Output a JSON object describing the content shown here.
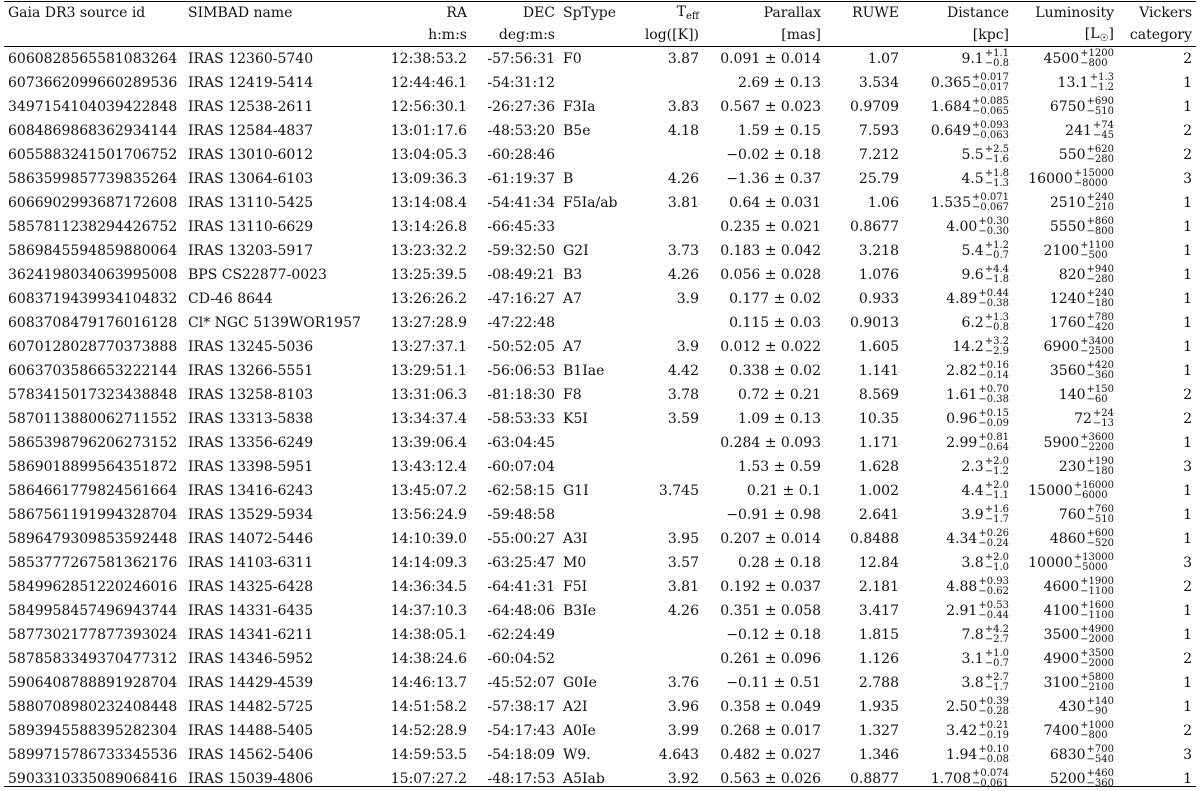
{
  "headers": {
    "gaia": "Gaia DR3 source id",
    "simbad": "SIMBAD name",
    "ra": "RA",
    "dec": "DEC",
    "sptype": "SpType",
    "teff_main": "T",
    "teff_sub": "eff",
    "parallax": "Parallax",
    "ruwe": "RUWE",
    "distance": "Distance",
    "luminosity": "Luminosity",
    "vickers": "Vickers"
  },
  "units": {
    "ra": "h:m:s",
    "dec": "deg:m:s",
    "teff": "log([K])",
    "parallax": "[mas]",
    "distance": "[kpc]",
    "luminosity_pre": "[L",
    "luminosity_sym": "☉",
    "luminosity_post": "]",
    "vickers": "category"
  },
  "rows": [
    {
      "gaia": "6060828565581083264",
      "name": "IRAS 12360-5740",
      "ra": "12:38:53.2",
      "dec": "-57:56:31",
      "sp": "F0",
      "teff": "3.87",
      "plx": "0.091 ± 0.014",
      "ruwe": "1.07",
      "dist": "9.1",
      "dist_up": "+1.1",
      "dist_dn": "−0.8",
      "lum": "4500",
      "lum_up": "+1200",
      "lum_dn": "−800",
      "vc": "2"
    },
    {
      "gaia": "6073662099660289536",
      "name": "IRAS 12419-5414",
      "ra": "12:44:46.1",
      "dec": "-54:31:12",
      "sp": "",
      "teff": "",
      "plx": "2.69 ± 0.13",
      "ruwe": "3.534",
      "dist": "0.365",
      "dist_up": "+0.017",
      "dist_dn": "−0.017",
      "lum": "13.1",
      "lum_up": "+1.3",
      "lum_dn": "−1.2",
      "vc": "1"
    },
    {
      "gaia": "3497154104039422848",
      "name": "IRAS 12538-2611",
      "ra": "12:56:30.1",
      "dec": "-26:27:36",
      "sp": "F3Ia",
      "teff": "3.83",
      "plx": "0.567 ± 0.023",
      "ruwe": "0.9709",
      "dist": "1.684",
      "dist_up": "+0.085",
      "dist_dn": "−0.065",
      "lum": "6750",
      "lum_up": "+690",
      "lum_dn": "−510",
      "vc": "1"
    },
    {
      "gaia": "6084869868362934144",
      "name": "IRAS 12584-4837",
      "ra": "13:01:17.6",
      "dec": "-48:53:20",
      "sp": "B5e",
      "teff": "4.18",
      "plx": "1.59 ± 0.15",
      "ruwe": "7.593",
      "dist": "0.649",
      "dist_up": "+0.093",
      "dist_dn": "−0.063",
      "lum": "241",
      "lum_up": "+74",
      "lum_dn": "−45",
      "vc": "2"
    },
    {
      "gaia": "6055883241501706752",
      "name": "IRAS 13010-6012",
      "ra": "13:04:05.3",
      "dec": "-60:28:46",
      "sp": "",
      "teff": "",
      "plx": "−0.02 ± 0.18",
      "ruwe": "7.212",
      "dist": "5.5",
      "dist_up": "+2.5",
      "dist_dn": "−1.6",
      "lum": "550",
      "lum_up": "+620",
      "lum_dn": "−280",
      "vc": "2"
    },
    {
      "gaia": "5863599857739835264",
      "name": "IRAS 13064-6103",
      "ra": "13:09:36.3",
      "dec": "-61:19:37",
      "sp": "B",
      "teff": "4.26",
      "plx": "−1.36 ± 0.37",
      "ruwe": "25.79",
      "dist": "4.5",
      "dist_up": "+1.8",
      "dist_dn": "−1.3",
      "lum": "16000",
      "lum_up": "+15000",
      "lum_dn": "−8000",
      "vc": "3"
    },
    {
      "gaia": "6066902993687172608",
      "name": "IRAS 13110-5425",
      "ra": "13:14:08.4",
      "dec": "-54:41:34",
      "sp": "F5Ia/ab",
      "teff": "3.81",
      "plx": "0.64 ± 0.031",
      "ruwe": "1.06",
      "dist": "1.535",
      "dist_up": "+0.071",
      "dist_dn": "−0.067",
      "lum": "2510",
      "lum_up": "+240",
      "lum_dn": "−210",
      "vc": "1"
    },
    {
      "gaia": "5857811238294426752",
      "name": "IRAS 13110-6629",
      "ra": "13:14:26.8",
      "dec": "-66:45:33",
      "sp": "",
      "teff": "",
      "plx": "0.235 ± 0.021",
      "ruwe": "0.8677",
      "dist": "4.00",
      "dist_up": "+0.30",
      "dist_dn": "−0.30",
      "lum": "5550",
      "lum_up": "+860",
      "lum_dn": "−800",
      "vc": "1"
    },
    {
      "gaia": "5869845594859880064",
      "name": "IRAS 13203-5917",
      "ra": "13:23:32.2",
      "dec": "-59:32:50",
      "sp": "G2I",
      "teff": "3.73",
      "plx": "0.183 ± 0.042",
      "ruwe": "3.218",
      "dist": "5.4",
      "dist_up": "+1.2",
      "dist_dn": "−0.7",
      "lum": "2100",
      "lum_up": "+1100",
      "lum_dn": "−500",
      "vc": "1"
    },
    {
      "gaia": "3624198034063995008",
      "name": "BPS CS22877-0023",
      "ra": "13:25:39.5",
      "dec": "-08:49:21",
      "sp": "B3",
      "teff": "4.26",
      "plx": "0.056 ± 0.028",
      "ruwe": "1.076",
      "dist": "9.6",
      "dist_up": "+4.4",
      "dist_dn": "−1.8",
      "lum": "820",
      "lum_up": "+940",
      "lum_dn": "−280",
      "vc": "1"
    },
    {
      "gaia": "6083719439934104832",
      "name": "CD-46 8644",
      "ra": "13:26:26.2",
      "dec": "-47:16:27",
      "sp": "A7",
      "teff": "3.9",
      "plx": "0.177 ± 0.02",
      "ruwe": "0.933",
      "dist": "4.89",
      "dist_up": "+0.44",
      "dist_dn": "−0.38",
      "lum": "1240",
      "lum_up": "+240",
      "lum_dn": "−180",
      "vc": "1"
    },
    {
      "gaia": "6083708479176016128",
      "name": "Cl* NGC 5139WOR1957",
      "ra": "13:27:28.9",
      "dec": "-47:22:48",
      "sp": "",
      "teff": "",
      "plx": "0.115 ± 0.03",
      "ruwe": "0.9013",
      "dist": "6.2",
      "dist_up": "+1.3",
      "dist_dn": "−0.8",
      "lum": "1760",
      "lum_up": "+780",
      "lum_dn": "−420",
      "vc": "1"
    },
    {
      "gaia": "6070128028770373888",
      "name": "IRAS 13245-5036",
      "ra": "13:27:37.1",
      "dec": "-50:52:05",
      "sp": "A7",
      "teff": "3.9",
      "plx": "0.012 ± 0.022",
      "ruwe": "1.605",
      "dist": "14.2",
      "dist_up": "+3.2",
      "dist_dn": "−2.9",
      "lum": "6900",
      "lum_up": "+3400",
      "lum_dn": "−2500",
      "vc": "1"
    },
    {
      "gaia": "6063703586653222144",
      "name": "IRAS 13266-5551",
      "ra": "13:29:51.1",
      "dec": "-56:06:53",
      "sp": "B1Iae",
      "teff": "4.42",
      "plx": "0.338 ± 0.02",
      "ruwe": "1.141",
      "dist": "2.82",
      "dist_up": "+0.16",
      "dist_dn": "−0.14",
      "lum": "3560",
      "lum_up": "+420",
      "lum_dn": "−360",
      "vc": "1"
    },
    {
      "gaia": "5783415017323438848",
      "name": "IRAS 13258-8103",
      "ra": "13:31:06.3",
      "dec": "-81:18:30",
      "sp": "F8",
      "teff": "3.78",
      "plx": "0.72 ± 0.21",
      "ruwe": "8.569",
      "dist": "1.61",
      "dist_up": "+0.70",
      "dist_dn": "−0.38",
      "lum": "140",
      "lum_up": "+150",
      "lum_dn": "−60",
      "vc": "2"
    },
    {
      "gaia": "5870113880062711552",
      "name": "IRAS 13313-5838",
      "ra": "13:34:37.4",
      "dec": "-58:53:33",
      "sp": "K5I",
      "teff": "3.59",
      "plx": "1.09 ± 0.13",
      "ruwe": "10.35",
      "dist": "0.96",
      "dist_up": "+0.15",
      "dist_dn": "−0.09",
      "lum": "72",
      "lum_up": "+24",
      "lum_dn": "−13",
      "vc": "2"
    },
    {
      "gaia": "5865398796206273152",
      "name": "IRAS 13356-6249",
      "ra": "13:39:06.4",
      "dec": "-63:04:45",
      "sp": "",
      "teff": "",
      "plx": "0.284 ± 0.093",
      "ruwe": "1.171",
      "dist": "2.99",
      "dist_up": "+0.81",
      "dist_dn": "−0.64",
      "lum": "5900",
      "lum_up": "+3600",
      "lum_dn": "−2200",
      "vc": "1"
    },
    {
      "gaia": "5869018899564351872",
      "name": "IRAS 13398-5951",
      "ra": "13:43:12.4",
      "dec": "-60:07:04",
      "sp": "",
      "teff": "",
      "plx": "1.53 ± 0.59",
      "ruwe": "1.628",
      "dist": "2.3",
      "dist_up": "+2.0",
      "dist_dn": "−1.2",
      "lum": "230",
      "lum_up": "+190",
      "lum_dn": "−180",
      "vc": "3"
    },
    {
      "gaia": "5864661779824561664",
      "name": "IRAS 13416-6243",
      "ra": "13:45:07.2",
      "dec": "-62:58:15",
      "sp": "G1I",
      "teff": "3.745",
      "plx": "0.21 ± 0.1",
      "ruwe": "1.002",
      "dist": "4.4",
      "dist_up": "+2.0",
      "dist_dn": "−1.1",
      "lum": "15000",
      "lum_up": "+16000",
      "lum_dn": "−6000",
      "vc": "1"
    },
    {
      "gaia": "5867561191994328704",
      "name": "IRAS 13529-5934",
      "ra": "13:56:24.9",
      "dec": "-59:48:58",
      "sp": "",
      "teff": "",
      "plx": "−0.91 ± 0.98",
      "ruwe": "2.641",
      "dist": "3.9",
      "dist_up": "+1.6",
      "dist_dn": "−1.7",
      "lum": "760",
      "lum_up": "+760",
      "lum_dn": "−510",
      "vc": "1"
    },
    {
      "gaia": "5896479309853592448",
      "name": "IRAS 14072-5446",
      "ra": "14:10:39.0",
      "dec": "-55:00:27",
      "sp": "A3I",
      "teff": "3.95",
      "plx": "0.207 ± 0.014",
      "ruwe": "0.8488",
      "dist": "4.34",
      "dist_up": "+0.26",
      "dist_dn": "−0.24",
      "lum": "4860",
      "lum_up": "+600",
      "lum_dn": "−520",
      "vc": "1"
    },
    {
      "gaia": "5853777267581362176",
      "name": "IRAS 14103-6311",
      "ra": "14:14:09.3",
      "dec": "-63:25:47",
      "sp": "M0",
      "teff": "3.57",
      "plx": "0.28 ± 0.18",
      "ruwe": "12.84",
      "dist": "3.8",
      "dist_up": "+2.0",
      "dist_dn": "−1.0",
      "lum": "10000",
      "lum_up": "+13000",
      "lum_dn": "−5000",
      "vc": "3"
    },
    {
      "gaia": "5849962851220246016",
      "name": "IRAS 14325-6428",
      "ra": "14:36:34.5",
      "dec": "-64:41:31",
      "sp": "F5I",
      "teff": "3.81",
      "plx": "0.192 ± 0.037",
      "ruwe": "2.181",
      "dist": "4.88",
      "dist_up": "+0.93",
      "dist_dn": "−0.62",
      "lum": "4600",
      "lum_up": "+1900",
      "lum_dn": "−1100",
      "vc": "2"
    },
    {
      "gaia": "5849958457496943744",
      "name": "IRAS 14331-6435",
      "ra": "14:37:10.3",
      "dec": "-64:48:06",
      "sp": "B3Ie",
      "teff": "4.26",
      "plx": "0.351 ± 0.058",
      "ruwe": "3.417",
      "dist": "2.91",
      "dist_up": "+0.53",
      "dist_dn": "−0.44",
      "lum": "4100",
      "lum_up": "+1600",
      "lum_dn": "−1100",
      "vc": "1"
    },
    {
      "gaia": "5877302177877393024",
      "name": "IRAS 14341-6211",
      "ra": "14:38:05.1",
      "dec": "-62:24:49",
      "sp": "",
      "teff": "",
      "plx": "−0.12 ± 0.18",
      "ruwe": "1.815",
      "dist": "7.8",
      "dist_up": "+4.2",
      "dist_dn": "−2.7",
      "lum": "3500",
      "lum_up": "+4900",
      "lum_dn": "−2000",
      "vc": "1"
    },
    {
      "gaia": "5878583349370477312",
      "name": "IRAS 14346-5952",
      "ra": "14:38:24.6",
      "dec": "-60:04:52",
      "sp": "",
      "teff": "",
      "plx": "0.261 ± 0.096",
      "ruwe": "1.126",
      "dist": "3.1",
      "dist_up": "+1.0",
      "dist_dn": "−0.7",
      "lum": "4900",
      "lum_up": "+3500",
      "lum_dn": "−2000",
      "vc": "2"
    },
    {
      "gaia": "5906408788891928704",
      "name": "IRAS 14429-4539",
      "ra": "14:46:13.7",
      "dec": "-45:52:07",
      "sp": "G0Ie",
      "teff": "3.76",
      "plx": "−0.11 ± 0.51",
      "ruwe": "2.788",
      "dist": "3.8",
      "dist_up": "+2.7",
      "dist_dn": "−1.7",
      "lum": "3100",
      "lum_up": "+5800",
      "lum_dn": "−2100",
      "vc": "1"
    },
    {
      "gaia": "5880708980232408448",
      "name": "IRAS 14482-5725",
      "ra": "14:51:58.2",
      "dec": "-57:38:17",
      "sp": "A2I",
      "teff": "3.96",
      "plx": "0.358 ± 0.049",
      "ruwe": "1.935",
      "dist": "2.50",
      "dist_up": "+0.39",
      "dist_dn": "−0.28",
      "lum": "430",
      "lum_up": "+140",
      "lum_dn": "−90",
      "vc": "1"
    },
    {
      "gaia": "5893945588395282304",
      "name": "IRAS 14488-5405",
      "ra": "14:52:28.9",
      "dec": "-54:17:43",
      "sp": "A0Ie",
      "teff": "3.99",
      "plx": "0.268 ± 0.017",
      "ruwe": "1.327",
      "dist": "3.42",
      "dist_up": "+0.21",
      "dist_dn": "−0.19",
      "lum": "7400",
      "lum_up": "+1000",
      "lum_dn": "−800",
      "vc": "2"
    },
    {
      "gaia": "5899715786733345536",
      "name": "IRAS 14562-5406",
      "ra": "14:59:53.5",
      "dec": "-54:18:09",
      "sp": "W9.",
      "teff": "4.643",
      "plx": "0.482 ± 0.027",
      "ruwe": "1.346",
      "dist": "1.94",
      "dist_up": "+0.10",
      "dist_dn": "−0.08",
      "lum": "6830",
      "lum_up": "+700",
      "lum_dn": "−540",
      "vc": "3"
    },
    {
      "gaia": "5903310335089068416",
      "name": "IRAS 15039-4806",
      "ra": "15:07:27.2",
      "dec": "-48:17:53",
      "sp": "A5Iab",
      "teff": "3.92",
      "plx": "0.563 ± 0.026",
      "ruwe": "0.8877",
      "dist": "1.708",
      "dist_up": "+0.074",
      "dist_dn": "−0.061",
      "lum": "5200",
      "lum_up": "+460",
      "lum_dn": "−360",
      "vc": "1"
    }
  ]
}
